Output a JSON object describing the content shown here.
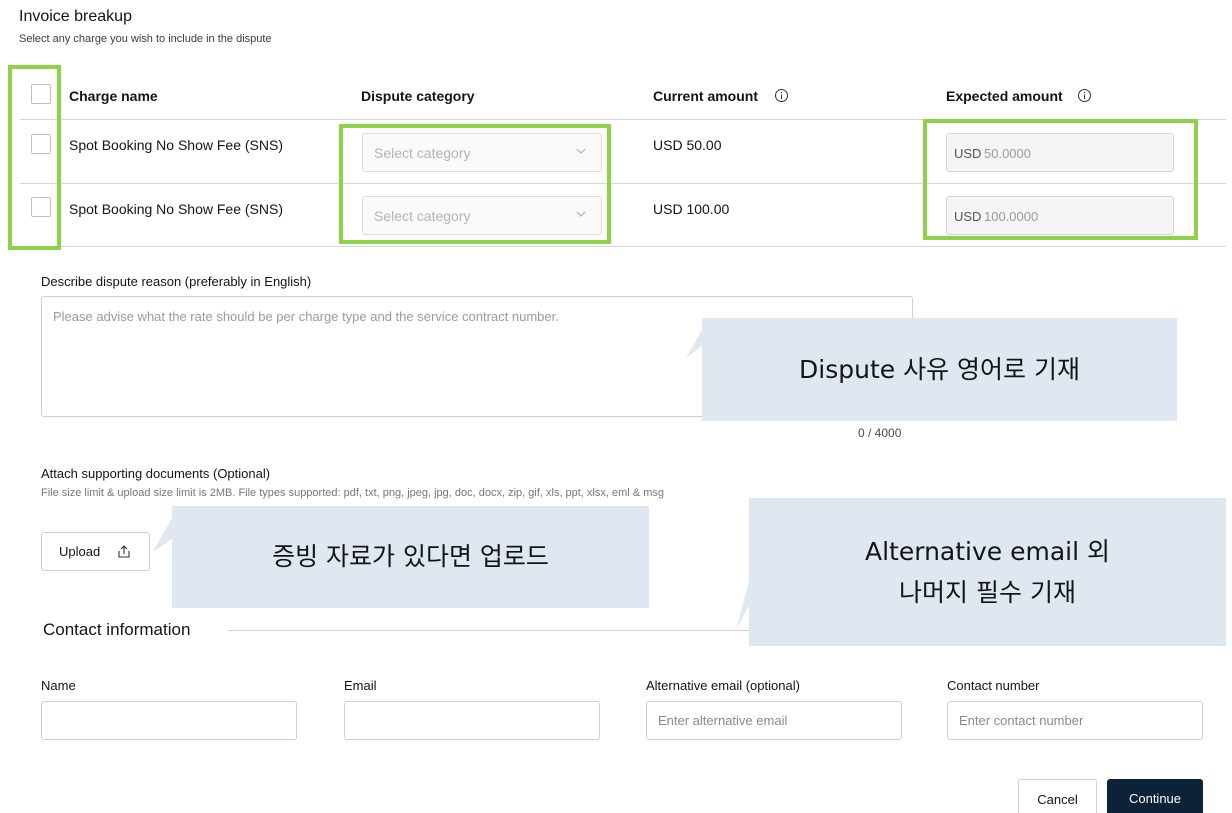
{
  "header": {
    "title": "Invoice breakup",
    "subtitle": "Select any charge you wish to include in the dispute"
  },
  "table": {
    "columns": {
      "charge_name": "Charge name",
      "dispute_category": "Dispute category",
      "current_amount": "Current amount",
      "expected_amount": "Expected amount"
    },
    "rows": [
      {
        "charge_name": "Spot Booking No Show Fee (SNS)",
        "category_placeholder": "Select category",
        "current_amount": "USD 50.00",
        "expected_currency": "USD",
        "expected_value": "50.0000"
      },
      {
        "charge_name": "Spot Booking No Show Fee (SNS)",
        "category_placeholder": "Select category",
        "current_amount": "USD 100.00",
        "expected_currency": "USD",
        "expected_value": "100.0000"
      }
    ]
  },
  "reason": {
    "label": "Describe dispute reason (preferably in English)",
    "placeholder": "Please advise what the rate should be per charge type and the service contract number.",
    "counter": "0 / 4000"
  },
  "attachments": {
    "label": "Attach supporting documents (Optional)",
    "note": "File size limit & upload size limit is 2MB. File types supported: pdf, txt, png, jpeg, jpg, doc, docx, zip, gif, xls, ppt, xlsx, eml & msg",
    "upload_label": "Upload"
  },
  "contact": {
    "section_title": "Contact information",
    "name_label": "Name",
    "email_label": "Email",
    "alt_email_label": "Alternative email (optional)",
    "alt_email_placeholder": "Enter alternative email",
    "contact_number_label": "Contact number",
    "contact_number_placeholder": "Enter contact number"
  },
  "actions": {
    "cancel_label": "Cancel",
    "continue_label": "Continue"
  },
  "callouts": {
    "reason_note": "Dispute 사유 영어로 기재",
    "upload_note": "증빙 자료가 있다면 업로드",
    "contact_note_line1": "Alternative email 외",
    "contact_note_line2": "나머지 필수 기재"
  },
  "icons": {
    "info": "info-icon",
    "chevron": "chevron-down-icon",
    "upload": "upload-icon"
  },
  "colors": {
    "highlight": "#8ed24a",
    "callout": "#dfe7f1",
    "primary_button": "#0b2239"
  }
}
